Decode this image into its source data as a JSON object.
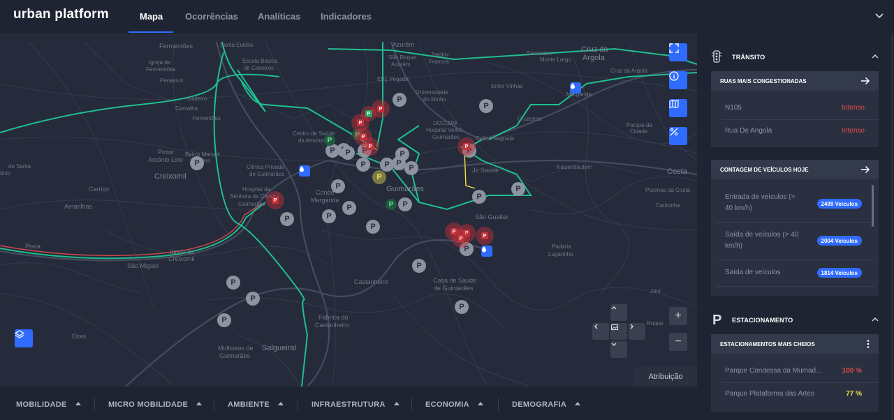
{
  "header": {
    "logo": "urban platform",
    "tabs": [
      {
        "label": "Mapa",
        "active": true
      },
      {
        "label": "Ocorrências",
        "active": false
      },
      {
        "label": "Analíticas",
        "active": false
      },
      {
        "label": "Indicadores",
        "active": false
      }
    ]
  },
  "map": {
    "labels": [
      {
        "text": "Fermentões"
      },
      {
        "text": "Santa Eulália"
      },
      {
        "text": "Igreja de"
      },
      {
        "text": "Fermentões"
      },
      {
        "text": "Penassol"
      },
      {
        "text": "Gaiteiro"
      },
      {
        "text": "Carvalha"
      },
      {
        "text": "Ferventões"
      },
      {
        "text": "Pintor"
      },
      {
        "text": "António Lino"
      },
      {
        "text": "Creixomil"
      },
      {
        "text": "Bairro Manuel"
      },
      {
        "text": "Moldes"
      },
      {
        "text": "Carriço"
      },
      {
        "text": "Amarilhas"
      },
      {
        "text": "Pisca"
      },
      {
        "text": "São Miguel"
      },
      {
        "text": "Igreja de"
      },
      {
        "text": "Creixomil"
      },
      {
        "text": "Eiras"
      },
      {
        "text": "Escola Básica"
      },
      {
        "text": "de Caneiros"
      },
      {
        "text": "Centro de Saúde"
      },
      {
        "text": "da Amorosa"
      },
      {
        "text": "Clínica Privada"
      },
      {
        "text": "de Guimarães"
      },
      {
        "text": "Hospital da"
      },
      {
        "text": "Senhora da Oliveira"
      },
      {
        "text": "Guimarães"
      },
      {
        "text": "Conde"
      },
      {
        "text": "Margaride"
      },
      {
        "text": "Guimarães"
      },
      {
        "text": "Salgueiral"
      },
      {
        "text": "Multiusos de"
      },
      {
        "text": "Guimarães"
      },
      {
        "text": "Fábrica do"
      },
      {
        "text": "Castanheiro"
      },
      {
        "text": "Castanheiro"
      },
      {
        "text": "Azurém"
      },
      {
        "text": "São Roque"
      },
      {
        "text": "Azurém"
      },
      {
        "text": "EB1 Pegada"
      },
      {
        "text": "Universidade"
      },
      {
        "text": "do Minho"
      },
      {
        "text": "UCCLDM"
      },
      {
        "text": "Hospital Velho,"
      },
      {
        "text": "Guimarães"
      },
      {
        "text": "Colina Sagrada"
      },
      {
        "text": "Jo Saúde"
      },
      {
        "text": "São Gualter"
      },
      {
        "text": "Casa de Saúde"
      },
      {
        "text": "de Guimarães"
      },
      {
        "text": "Entre Vinhas"
      },
      {
        "text": "Seminário"
      },
      {
        "text": "Monte Largo"
      },
      {
        "text": "Cruz da"
      },
      {
        "text": "Argola"
      },
      {
        "text": "Cruz da Argola"
      },
      {
        "text": "Margaride"
      },
      {
        "text": "Cruzeiros"
      },
      {
        "text": "Parque da"
      },
      {
        "text": "Cidade"
      },
      {
        "text": "Kaiserslautern"
      },
      {
        "text": "Costa"
      },
      {
        "text": "Piscinas da Costa"
      },
      {
        "text": "Cantonha"
      },
      {
        "text": "Padaria"
      },
      {
        "text": "Lugarinho"
      },
      {
        "text": "Júni"
      },
      {
        "text": "Roque"
      },
      {
        "text": "de Santa"
      },
      {
        "text": "ônio"
      },
      {
        "text": "Jardim-"
      },
      {
        "text": "Francos"
      }
    ],
    "parking_marker_label": "P",
    "attribution": "Atribuição",
    "zoom_in": "+",
    "zoom_out": "−"
  },
  "bottom_tabs": [
    {
      "label": "MOBILIDADE"
    },
    {
      "label": "MICRO MOBILIDADE"
    },
    {
      "label": "AMBIENTE"
    },
    {
      "label": "INFRAESTRUTURA"
    },
    {
      "label": "ECONOMIA"
    },
    {
      "label": "DEMOGRAFIA"
    }
  ],
  "sidebar": {
    "transito": {
      "title": "TRÂNSITO",
      "ruas_card": {
        "title": "RUAS MAIS CONGESTIONADAS",
        "rows": [
          {
            "name": "N105",
            "status": "Intenso"
          },
          {
            "name": "Rua De Angola",
            "status": "Intenso"
          }
        ]
      },
      "contagem_card": {
        "title": "CONTAGEM DE VEÍCULOS HOJE",
        "rows": [
          {
            "label_line1": "Entrada de veículos (>",
            "label_line2": "40 km/h)",
            "value": "2499 Veículos"
          },
          {
            "label_line1": "Saída de veículos (> 40",
            "label_line2": "km/h)",
            "value": "2004 Veículos"
          },
          {
            "label_line1": "Saída de veículos",
            "label_line2": "",
            "value": "1814 Veículos"
          }
        ]
      }
    },
    "estacionamento": {
      "icon_letter": "P",
      "title": "ESTACIONAMENTO",
      "cheios_card": {
        "title": "ESTACIONAMENTOS MAIS CHEIOS",
        "rows": [
          {
            "name": "Parque Condessa da Mumad...",
            "percent": "100 %"
          },
          {
            "name": "Parque Plataforma das Artes",
            "percent": "77 %"
          }
        ]
      }
    }
  },
  "colors": {
    "accent": "#2f6bff",
    "route_green": "#1fbf8f",
    "status_red": "#e24c4c",
    "status_yellow": "#f5e24a",
    "marker_grey": "#8d93a0",
    "marker_red": "#c8313a",
    "marker_green": "#2ea866"
  }
}
